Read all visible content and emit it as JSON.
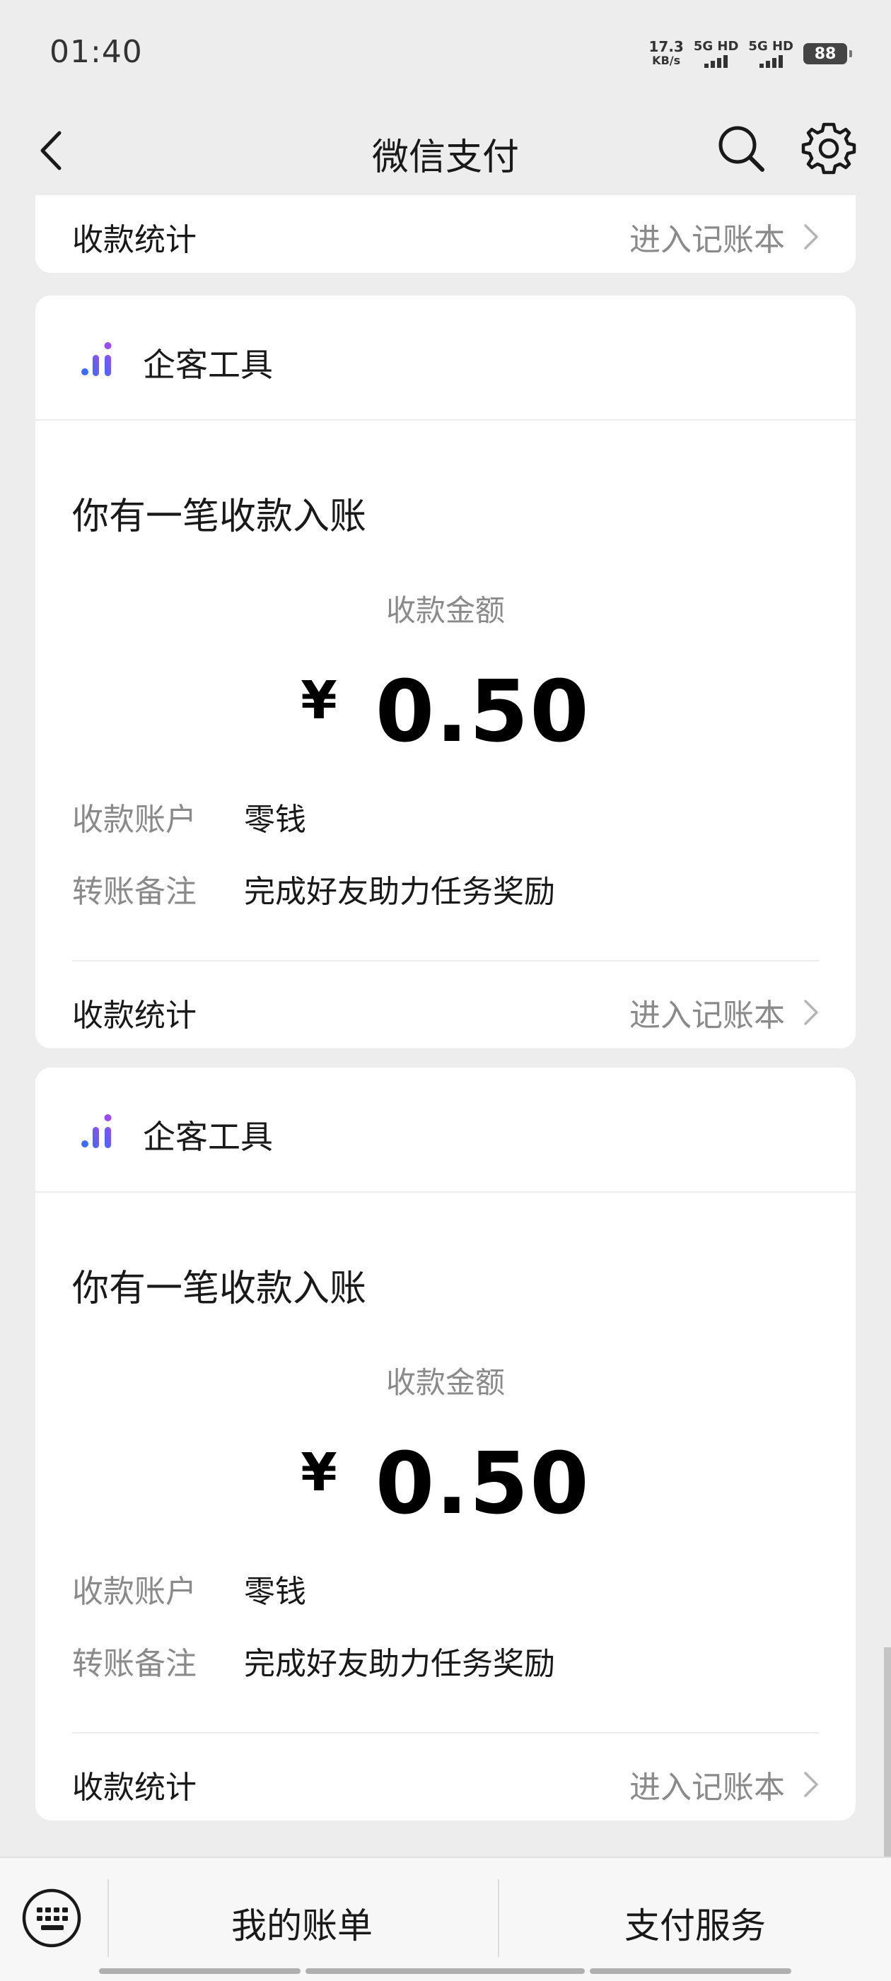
{
  "status_bar": {
    "time": "01:40",
    "speed_value": "17.3",
    "speed_unit": "KB/s",
    "network_1": "5G HD",
    "network_2": "5G HD",
    "battery": "88"
  },
  "nav": {
    "title": "微信支付",
    "back_icon": "chevron-left-icon",
    "search_icon": "search-icon",
    "settings_icon": "gear-icon"
  },
  "top_partial_card": {
    "stat_label": "收款统计",
    "stat_link": "进入记账本"
  },
  "cards": [
    {
      "source": "企客工具",
      "heading": "你有一笔收款入账",
      "amount_label": "收款金额",
      "currency": "¥",
      "amount": "0.50",
      "account_label": "收款账户",
      "account_value": "零钱",
      "note_label": "转账备注",
      "note_value": "完成好友助力任务奖励",
      "stat_label": "收款统计",
      "stat_link": "进入记账本"
    },
    {
      "source": "企客工具",
      "heading": "你有一笔收款入账",
      "amount_label": "收款金额",
      "currency": "¥",
      "amount": "0.50",
      "account_label": "收款账户",
      "account_value": "零钱",
      "note_label": "转账备注",
      "note_value": "完成好友助力任务奖励",
      "stat_label": "收款统计",
      "stat_link": "进入记账本"
    }
  ],
  "bottom_bar": {
    "keyboard_icon": "keyboard-icon",
    "my_bills": "我的账单",
    "pay_services": "支付服务"
  },
  "colors": {
    "background": "#ededed",
    "card": "#ffffff",
    "secondary_text": "#8a8a8a",
    "logo_gradient": [
      "#3b6cf6",
      "#8a4cf0"
    ]
  }
}
